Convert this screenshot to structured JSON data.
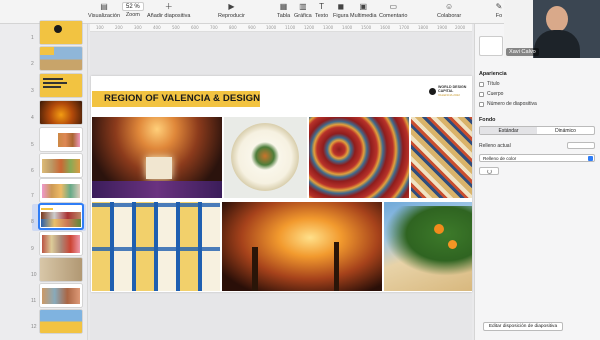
{
  "toolbar": {
    "items": [
      {
        "label": "Visualización",
        "icon": "sidebar-icon"
      },
      {
        "label": "Zoom",
        "icon": "zoom-icon",
        "value": "52 %"
      },
      {
        "label": "Añadir diapositiva",
        "icon": "plus-icon"
      },
      {
        "label": "Reproducir",
        "icon": "play-icon"
      },
      {
        "label": "Tabla",
        "icon": "table-icon"
      },
      {
        "label": "Gráfica",
        "icon": "chart-icon"
      },
      {
        "label": "Texto",
        "icon": "text-icon"
      },
      {
        "label": "Figura",
        "icon": "shape-icon"
      },
      {
        "label": "Multimedia",
        "icon": "media-icon"
      },
      {
        "label": "Comentario",
        "icon": "comment-icon"
      },
      {
        "label": "Colaborar",
        "icon": "collaborate-icon"
      },
      {
        "label": "Fo",
        "icon": "format-icon"
      }
    ]
  },
  "ruler": {
    "ticks": [
      "100",
      "200",
      "300",
      "400",
      "500",
      "600",
      "700",
      "800",
      "900",
      "1000",
      "1100",
      "1200",
      "1300",
      "1400",
      "1500",
      "1600",
      "1700",
      "1800",
      "1900",
      "2000"
    ]
  },
  "thumbnails": {
    "numbers": [
      "1",
      "2",
      "3",
      "4",
      "5",
      "6",
      "7",
      "8",
      "9",
      "10",
      "11",
      "12"
    ],
    "selected": 8
  },
  "slide": {
    "title": "REGION OF VALENCIA & DESIGN",
    "logo_line1": "WORLD DESIGN",
    "logo_line2": "CAPITAL",
    "logo_line3": "VALENCIA 2022"
  },
  "video": {
    "name": "Xavi Calvo"
  },
  "inspector": {
    "section_appearance": "Apariencia",
    "checks": [
      "Título",
      "Cuerpo",
      "Número de diapositiva"
    ],
    "section_background": "Fondo",
    "seg_standard": "Estándar",
    "seg_dynamic": "Dinámico",
    "current_fill": "Relleno actual",
    "fill_select": "Relleno de color",
    "edit_button": "Editar disposición de diapositiva"
  },
  "colors": {
    "accent": "#2f7df6",
    "title_bar": "#f2c341"
  }
}
